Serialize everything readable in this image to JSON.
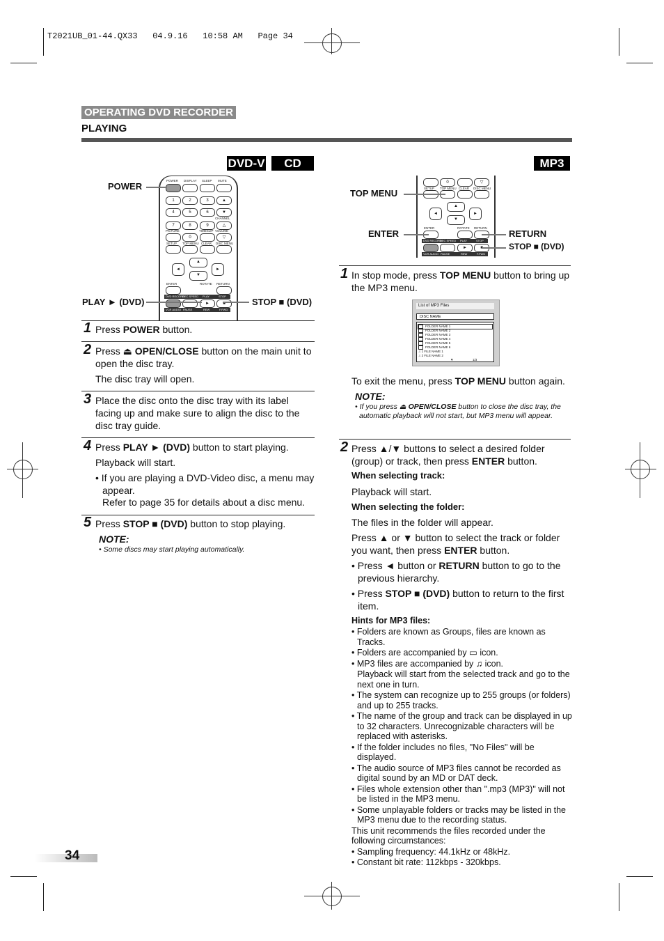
{
  "print_header": {
    "text": "T2021UB_01-44.QX33   04.9.16   10:58 AM   Page 34"
  },
  "section": {
    "tag": "OPERATING DVD RECORDER",
    "title": "PLAYING"
  },
  "left": {
    "badges": [
      "DVD-V",
      "CD"
    ],
    "callouts": {
      "power": "POWER",
      "play": "PLAY ► (DVD)",
      "stop": "STOP ■ (DVD)"
    },
    "remote": {
      "row1": [
        "POWER",
        "DISPLAY",
        "SLEEP",
        "MUTE"
      ],
      "digits": [
        "1",
        "2",
        "3",
        "4",
        "5",
        "6",
        "7",
        "8",
        "9",
        "0"
      ],
      "labels": {
        "picture": "PICTURE",
        "timeslip": "TIMESLIP",
        "volume": "VOLUME",
        "channel": "CHANNEL",
        "setup": "SETUP",
        "topmenu": "TOP MENU",
        "clear": "CLEAR",
        "discmenu": "DISC MENU",
        "enter": "ENTER",
        "rotate": "ROTATE",
        "return": "RETURN"
      },
      "band1": [
        "DVD RECORD",
        "REC SPEED",
        "PLAY",
        "STOP"
      ],
      "band2": [
        "VCR AUDIO",
        "PAUSE",
        "REW",
        "F.FWD"
      ]
    },
    "steps": [
      {
        "num": "1",
        "text_html": "Press <b>POWER</b> button."
      },
      {
        "num": "2",
        "text_html": "Press ⏏ <b>OPEN/CLOSE</b> button on the main unit to open the disc tray.",
        "sub": "The disc tray will open."
      },
      {
        "num": "3",
        "text_html": "Place the disc onto the disc tray with its label facing up and make sure to align the disc to the disc tray guide."
      },
      {
        "num": "4",
        "text_html": "Press <b>PLAY ► (DVD)</b> button to start playing.",
        "sub": "Playback will start.",
        "bullet": "• If you are playing a DVD-Video disc, a menu may appear.",
        "bullet2": "Refer to page 35 for details about a disc menu."
      },
      {
        "num": "5",
        "text_html": "Press <b>STOP ■ (DVD)</b> button to stop playing."
      }
    ],
    "note": {
      "heading": "NOTE:",
      "text": "• Some discs may start playing automatically."
    }
  },
  "right": {
    "badge": "MP3",
    "callouts": {
      "top_menu": "TOP MENU",
      "enter": "ENTER",
      "return": "RETURN",
      "stop": "STOP ■ (DVD)"
    },
    "step1": {
      "num": "1",
      "text_html": "In stop mode, press <b>TOP MENU</b> button to bring up the MP3 menu."
    },
    "mp3_menu": {
      "title": "List of MP3 Files",
      "disc_name": "DISC NAME",
      "folders": [
        "FOLDER NAME 1",
        "FOLDER NAME 2",
        "FOLDER NAME 3",
        "FOLDER NAME 4",
        "FOLDER NAME 5",
        "FOLDER NAME 6"
      ],
      "files": [
        {
          "n": "1",
          "name": "FILE NAME 1"
        },
        {
          "n": "2",
          "name": "FILE NAME 2"
        }
      ],
      "page": "1/3"
    },
    "exit_html": "To exit the menu, press <b>TOP MENU</b> button again.",
    "note": {
      "heading": "NOTE:",
      "text_html": "• If you press ⏏ <b>OPEN/CLOSE</b> button to close the disc tray, the automatic playback will not start, but MP3 menu will appear."
    },
    "step2": {
      "num": "2",
      "text_html": "Press ▲/▼ buttons to select a desired folder (group) or track, then press <b>ENTER</b> button.",
      "track_h": "When selecting track:",
      "track_t": "Playback will start.",
      "folder_h": "When selecting the folder:",
      "folder_t": "The files in the folder will appear.",
      "select_html": "Press ▲ or ▼ button to select the track or folder you want, then press <b>ENTER</b> button.",
      "bullet1_html": "• Press ◄ button or <b>RETURN</b> button to go to the previous hierarchy.",
      "bullet2_html": "• Press <b>STOP ■ (DVD)</b> button to return to the first item."
    },
    "hints": {
      "heading": "Hints for MP3 files:",
      "items": [
        "• Folders are known as Groups, files are known as Tracks.",
        "• Folders are accompanied by ▭ icon.",
        "• MP3 files are accompanied by ♫ icon.",
        "Playback will start from the selected track and go to the next one in turn.",
        "• The system can recognize up to 255 groups (or folders) and up to 255 tracks.",
        "• The name of the group and track can be displayed in up to 32 characters. Unrecognizable characters will be replaced with asterisks.",
        "• If the folder includes no files, \"No Files\" will be displayed.",
        "• The audio source of MP3 files cannot be recorded as digital sound by an MD or DAT deck.",
        "• Files whole extension other than \".mp3 (MP3)\" will not be listed in the MP3 menu.",
        "• Some unplayable folders or tracks may be listed in the MP3 menu due to the recording status.",
        "This unit recommends the files recorded under the following circumstances:",
        "• Sampling frequency: 44.1kHz or 48kHz.",
        "• Constant bit rate: 112kbps - 320kbps."
      ]
    }
  },
  "page_number": "34"
}
